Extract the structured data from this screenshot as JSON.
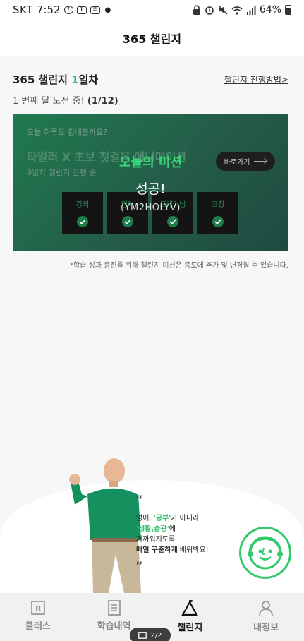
{
  "status_bar": {
    "carrier": "SKT",
    "time": "7:52",
    "battery": "64%"
  },
  "header": {
    "title": "365 챌린지"
  },
  "progress": {
    "title_prefix": "365 챌린지 ",
    "day_number": "1",
    "title_suffix": "일차",
    "howto_link": "챌린지 진행방법>",
    "attempt_text": "1 번째 달 도전 중! ",
    "attempt_count": "(1/12)"
  },
  "mission_card": {
    "greeting": "오늘 하루도 힘내볼까요?",
    "title": "타일러 X 초보 첫걸음 애니메이션",
    "day_status": "9일차 챌린지 진행 중",
    "go_button": "바로가기",
    "tiles": [
      {
        "label": "강의"
      },
      {
        "label": "영어"
      },
      {
        "label": "트레이닝"
      },
      {
        "label": "코칭"
      }
    ],
    "success_title": "오늘의 미션",
    "success_text": "성공!",
    "code": "(YM2HOLYV)"
  },
  "notice": "*학습 성과 증진을 위해 챌린지 미션은 중도에 추가 및 변경될 수 있습니다.",
  "promo": {
    "line1_a": "영어, ",
    "line1_b": "'공부'",
    "line1_c": "가 아니라",
    "line2_a": "'생활,습관'",
    "line2_b": "에",
    "line3": "가까워지도록",
    "line4_a": "매일 꾸준하게",
    "line4_b": " 배워봐요!"
  },
  "bottom_nav": {
    "items": [
      {
        "label": "클래스"
      },
      {
        "label": "학습내역"
      },
      {
        "label": "챌린지"
      },
      {
        "label": "내정보"
      }
    ]
  },
  "page_indicator": "2/2",
  "colors": {
    "accent": "#2fbf6a",
    "card": "#245c48"
  }
}
